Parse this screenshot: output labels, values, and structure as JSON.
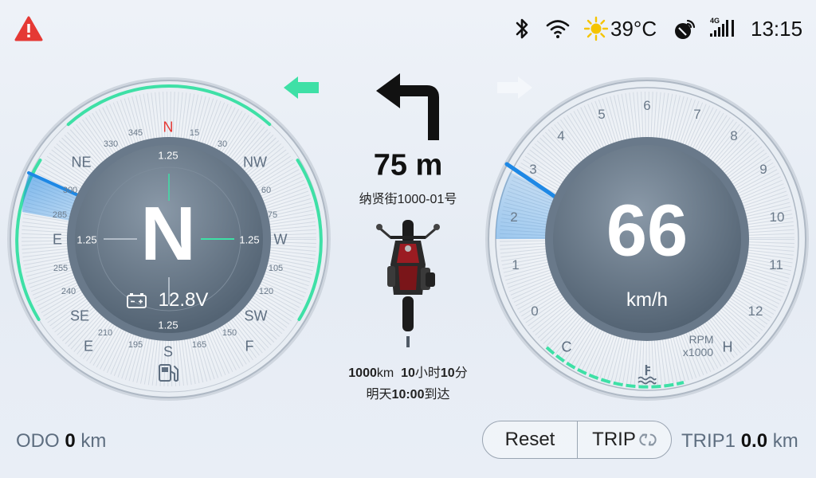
{
  "status": {
    "temperature": "39°C",
    "network_label": "4G",
    "time": "13:15",
    "icons": [
      "warning-icon",
      "bluetooth-icon",
      "wifi-icon",
      "sun-icon",
      "gps-icon",
      "cellular-signal-icon"
    ]
  },
  "compass": {
    "heading": "N",
    "voltage": "12.8V",
    "battery_icon": "battery-icon",
    "fuel_icon": "fuel-pump-icon",
    "cardinals": {
      "n": "N",
      "ne": "NE",
      "nw": "NW",
      "e": "E",
      "w": "W",
      "se": "SE",
      "sw": "SW",
      "e2": "E",
      "f": "F",
      "s": "S"
    },
    "degrees": {
      "d345": "345",
      "d15": "15",
      "d330": "330",
      "d30": "30",
      "d300": "300",
      "d60": "60",
      "d285": "285",
      "d75": "75",
      "d255": "255",
      "d105": "105",
      "d240": "240",
      "d120": "120",
      "d210": "210",
      "d150": "150",
      "d195": "195",
      "d165": "165"
    },
    "inner_scale": {
      "top": "1.25",
      "left": "1.25",
      "right": "1.25",
      "bottom": "1.25"
    },
    "accent": "#3ee0a6"
  },
  "navigation": {
    "turn_direction": "left",
    "distance": "75 m",
    "street": "纳贤街1000-01号",
    "eta_line1": {
      "distance_value": "1000",
      "distance_unit": "km",
      "hours": "10",
      "hours_unit": "小时",
      "minutes": "10",
      "minutes_unit": "分"
    },
    "eta_line2": {
      "prefix": "明天",
      "time": "10:00",
      "suffix": "到达"
    },
    "left_signal_active": true,
    "right_signal_active": false
  },
  "speedometer": {
    "speed": "66",
    "unit": "km/h",
    "rpm_label_1": "RPM",
    "rpm_label_2": "x1000",
    "temp_cold": "C",
    "temp_hot": "H",
    "coolant_icon": "coolant-temperature-icon",
    "rpm_ticks": [
      "0",
      "1",
      "2",
      "3",
      "4",
      "5",
      "6",
      "7",
      "8",
      "9",
      "10",
      "11",
      "12"
    ],
    "rpm_value": 3.2,
    "accent_rpm": "#1e88e5"
  },
  "bottom": {
    "odo_label": "ODO",
    "odo_value": "0",
    "odo_unit": "km",
    "reset_label": "Reset",
    "trip_label": "TRIP",
    "trip1_label": "TRIP1",
    "trip1_value": "0.0",
    "trip1_unit": "km"
  }
}
